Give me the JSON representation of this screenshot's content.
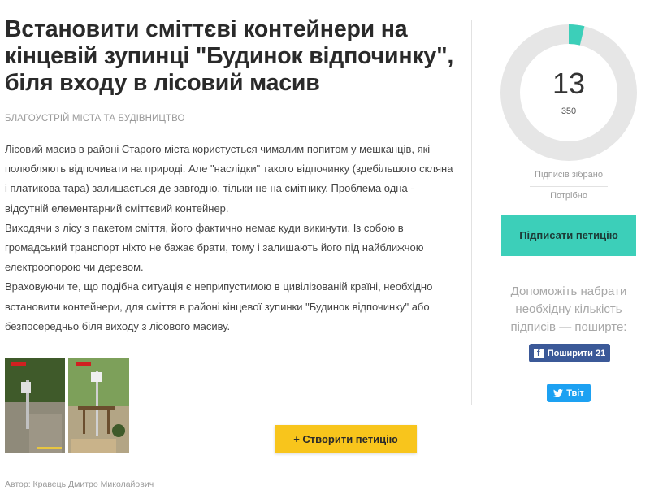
{
  "petition": {
    "title": "Встановити сміттєві контейнери на кінцевій зупинці \"Будинок відпочинку\", біля входу в лісовий масив",
    "category": "БЛАГОУСТРІЙ МІСТА ТА БУДІВНИЦТВО",
    "paragraphs": [
      "Лісовий масив в районі Старого міста користується чималим попитом у мешканців, які полюбляють відпочивати на природі. Але \"наслідки\" такого відпочинку (здебільшого скляна і платикова тара) залишається де завгодно, тільки не на смітнику. Проблема одна - відсутній елементарний сміттєвий контейнер.",
      "Виходячи з лісу з пакетом сміття, його фактично немає куди викинути. Із собою в громадський транспорт ніхто не бажає брати, тому і залишають його під найближчою електроопорою чи деревом.",
      "Враховуючи те, що подібна ситуація є неприпустимою в цивілізованій країні, необхідно встановити контейнери, для сміття в районі кінцевої зупинки \"Будинок відпочинку\" або безпосередньо біля виходу з лісового масиву."
    ],
    "author": "Автор: Кравець Дмитро Миколайович"
  },
  "actions": {
    "create_label": "+ Створити петицію",
    "sign_label": "Підписати петицію",
    "help_text": "Допоможіть набрати необхідну кількість підписів — поширте:",
    "share_fb_label": "Поширити 21",
    "share_tw_label": "Твіт"
  },
  "signatures": {
    "count": "13",
    "goal": "350",
    "collected_label": "Підписів зібрано",
    "needed_label": "Потрібно",
    "progress_fraction": 0.0371
  },
  "colors": {
    "accent": "#3ccfb9",
    "create_button": "#f8c51c",
    "facebook": "#3b5998",
    "twitter": "#1da1f2",
    "ring_track": "#e6e6e6"
  },
  "icons": {
    "facebook": "facebook-icon",
    "twitter": "twitter-icon"
  }
}
